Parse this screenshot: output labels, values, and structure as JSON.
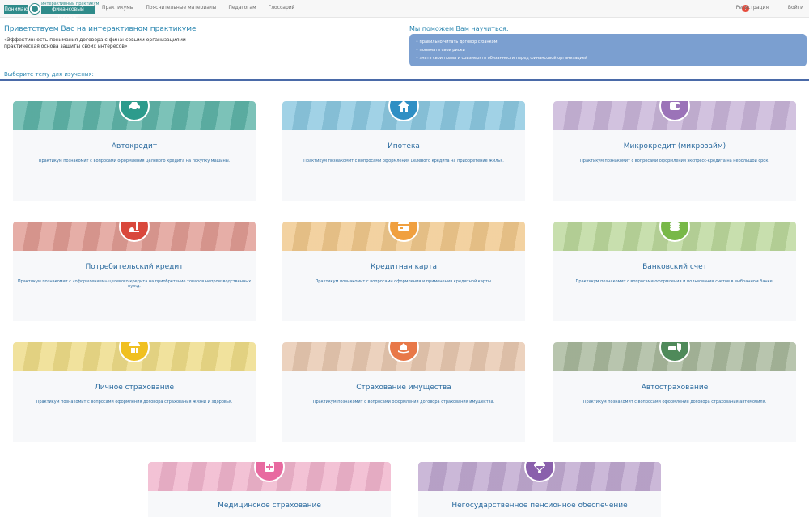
{
  "logo": {
    "left_text": "Понимаю",
    "top_text": "интерактивный практикум",
    "right_text": "финансовый договор"
  },
  "nav": {
    "items": [
      "Практикумы",
      "Пояснительные материалы",
      "Педагогам",
      "Глоссарий"
    ]
  },
  "top_right": {
    "help_label": "?",
    "register_label": "Регистрация",
    "login_label": "Войти"
  },
  "welcome": {
    "title": "Приветствуем Вас на интерактивном практикуме",
    "subtitle": "«Эффективность понимания договора с финансовыми организациями – практическая основа защиты своих интересов»"
  },
  "help": {
    "title": "Мы поможем Вам научиться:",
    "items": [
      "правильно читать договор с банком",
      "понимать свои риски",
      "знать свои права и соизмерять обязанности перед финансовой организацией"
    ]
  },
  "choose_title": "Выберите тему для изучения:",
  "cards": [
    {
      "title": "Автокредит",
      "desc": "Практикум познакомит с вопросами оформления целевого кредита на покупку машины.",
      "icon": "car-icon",
      "band_color": "#5fb4a8",
      "circle_color": "#2d9b8c"
    },
    {
      "title": "Ипотека",
      "desc": "Практикум познакомит с вопросами оформления целевого кредита на приобретение жилья.",
      "icon": "house-icon",
      "band_color": "#8cc8e0",
      "circle_color": "#2f8fc4"
    },
    {
      "title": "Микрокредит (микрозайм)",
      "desc": "Практикум познакомит с вопросами оформления экспресс-кредита на небольшой срок.",
      "icon": "wallet-icon",
      "band_color": "#c8b4d8",
      "circle_color": "#9b73b8"
    },
    {
      "title": "Потребительский кредит",
      "desc": "Практикум познакомит с «оформлением» целевого кредита на приобретение товаров непроизводственных нужд.",
      "icon": "vacuum-icon",
      "band_color": "#e09c94",
      "circle_color": "#d9483c"
    },
    {
      "title": "Кредитная карта",
      "desc": "Практикум познакомит с вопросами оформления и применения кредитной карты.",
      "icon": "credit-card-icon",
      "band_color": "#f0c88c",
      "circle_color": "#f0a040"
    },
    {
      "title": "Банковский счет",
      "desc": "Практикум познакомит с вопросами оформления и пользования счетов в выбранном банке.",
      "icon": "coins-icon",
      "band_color": "#bcd89c",
      "circle_color": "#78b848"
    },
    {
      "title": "Личное страхование",
      "desc": "Практикум познакомит с вопросами оформления договора страхования жизни и здоровья.",
      "icon": "umbrella-family-icon",
      "band_color": "#eedc88",
      "circle_color": "#f0c020"
    },
    {
      "title": "Страхование имущества",
      "desc": "Практикум познакомит с вопросами оформления договора страхования имущества.",
      "icon": "hand-house-icon",
      "band_color": "#e8c8b0",
      "circle_color": "#e87848"
    },
    {
      "title": "Автострахование",
      "desc": "Практикум познакомит с вопросами оформления договора страхования автомобиля.",
      "icon": "car-shield-icon",
      "band_color": "#a8b89c",
      "circle_color": "#4f8a5a"
    },
    {
      "title": "Медицинское страхование",
      "desc": "",
      "icon": "medical-icon",
      "band_color": "#f0b4cc",
      "circle_color": "#e86aa0"
    },
    {
      "title": "Негосударственное пенсионное обеспечение",
      "desc": "",
      "icon": "parachute-icon",
      "band_color": "#c0a8d0",
      "circle_color": "#8a60ac"
    }
  ]
}
